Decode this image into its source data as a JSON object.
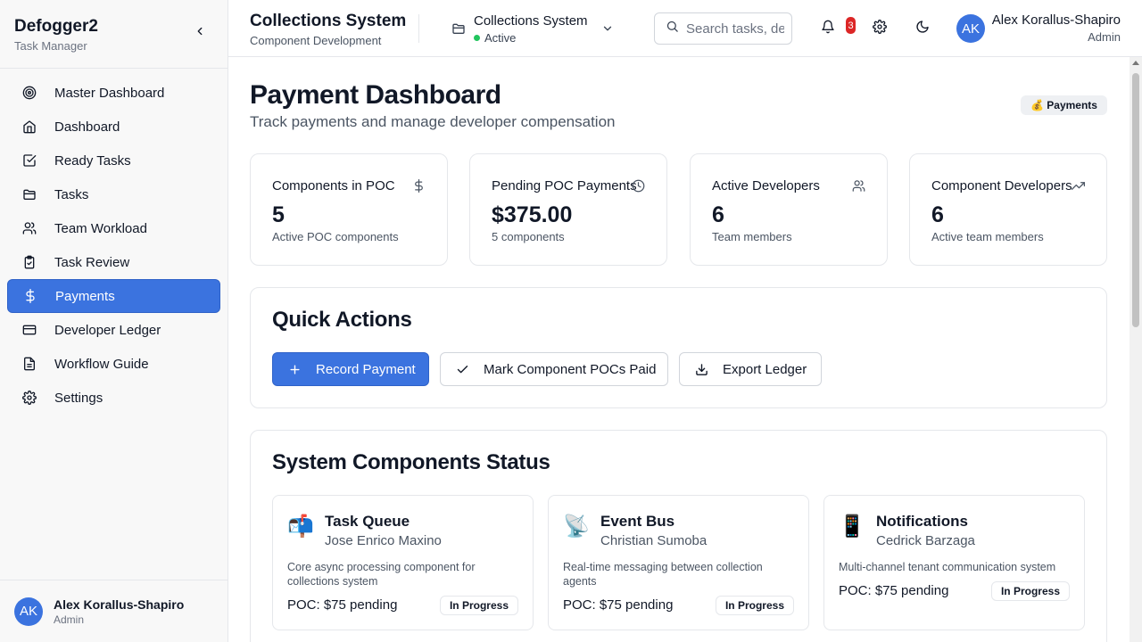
{
  "sidebar": {
    "brand_title": "Defogger2",
    "brand_subtitle": "Task Manager",
    "items": [
      {
        "label": "Master Dashboard",
        "icon": "target-icon"
      },
      {
        "label": "Dashboard",
        "icon": "home-icon"
      },
      {
        "label": "Ready Tasks",
        "icon": "checkbox-icon"
      },
      {
        "label": "Tasks",
        "icon": "folder-icon"
      },
      {
        "label": "Team Workload",
        "icon": "users-icon"
      },
      {
        "label": "Task Review",
        "icon": "clipboard-check-icon"
      },
      {
        "label": "Payments",
        "icon": "dollar-icon",
        "active": true
      },
      {
        "label": "Developer Ledger",
        "icon": "credit-card-icon"
      },
      {
        "label": "Workflow Guide",
        "icon": "document-icon"
      },
      {
        "label": "Settings",
        "icon": "gear-icon"
      }
    ],
    "user": {
      "initials": "AK",
      "name": "Alex Korallus-Shapiro",
      "role": "Admin"
    }
  },
  "header": {
    "title": "Collections System",
    "subtitle": "Component Development",
    "project": {
      "name": "Collections System",
      "status": "Active"
    },
    "search_placeholder": "Search tasks, developers...",
    "notification_count": "3",
    "user": {
      "initials": "AK",
      "name": "Alex Korallus-Shapiro",
      "role": "Admin"
    }
  },
  "page": {
    "title": "Payment Dashboard",
    "subtitle": "Track payments and manage developer compensation",
    "tag": "💰 Payments"
  },
  "stats": [
    {
      "label": "Components in POC",
      "value": "5",
      "note": "Active POC components",
      "icon": "dollar-icon"
    },
    {
      "label": "Pending POC Payments",
      "value": "$375.00",
      "note": "5 components",
      "icon": "clock-icon"
    },
    {
      "label": "Active Developers",
      "value": "6",
      "note": "Team members",
      "icon": "users-icon"
    },
    {
      "label": "Component Developers",
      "value": "6",
      "note": "Active team members",
      "icon": "trending-up-icon"
    }
  ],
  "quick_actions": {
    "title": "Quick Actions",
    "buttons": [
      {
        "label": "Record Payment",
        "icon": "plus-icon"
      },
      {
        "label": "Mark Component POCs Paid",
        "icon": "check-icon"
      },
      {
        "label": "Export Ledger",
        "icon": "download-icon"
      }
    ]
  },
  "components": {
    "title": "System Components Status",
    "items": [
      {
        "emoji": "📬",
        "name": "Task Queue",
        "developer": "Jose Enrico Maxino",
        "description": "Core async processing component for collections system",
        "poc": "POC: $75 pending",
        "status": "In Progress"
      },
      {
        "emoji": "📡",
        "name": "Event Bus",
        "developer": "Christian Sumoba",
        "description": "Real-time messaging between collection agents",
        "poc": "POC: $75 pending",
        "status": "In Progress"
      },
      {
        "emoji": "📱",
        "name": "Notifications",
        "developer": "Cedrick Barzaga",
        "description": "Multi-channel tenant communication system",
        "poc": "POC: $75 pending",
        "status": "In Progress"
      }
    ]
  }
}
